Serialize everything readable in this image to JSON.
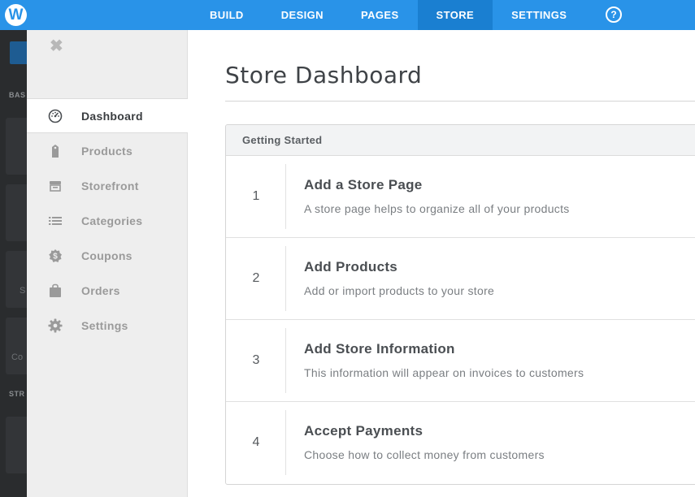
{
  "app": {
    "logo_letter": "W"
  },
  "nav": {
    "items": [
      {
        "label": "BUILD"
      },
      {
        "label": "DESIGN"
      },
      {
        "label": "PAGES"
      },
      {
        "label": "STORE"
      },
      {
        "label": "SETTINGS"
      }
    ],
    "active": "STORE",
    "help_label": "?"
  },
  "editor_strip": {
    "labels": [
      "BAS",
      "STR"
    ],
    "texts": [
      "S",
      "Co"
    ]
  },
  "sidebar": {
    "close_icon": "close-icon",
    "items": [
      {
        "label": "Dashboard",
        "icon": "gauge-icon",
        "active": true
      },
      {
        "label": "Products",
        "icon": "tag-icon",
        "active": false
      },
      {
        "label": "Storefront",
        "icon": "storefront-icon",
        "active": false
      },
      {
        "label": "Categories",
        "icon": "list-icon",
        "active": false
      },
      {
        "label": "Coupons",
        "icon": "coupon-icon",
        "active": false
      },
      {
        "label": "Orders",
        "icon": "shopping-bag-icon",
        "active": false
      },
      {
        "label": "Settings",
        "icon": "gear-icon",
        "active": false
      }
    ]
  },
  "main": {
    "title": "Store Dashboard",
    "panel": {
      "header": "Getting Started",
      "steps": [
        {
          "number": "1",
          "title": "Add a Store Page",
          "description": "A store page helps to organize all of your products"
        },
        {
          "number": "2",
          "title": "Add Products",
          "description": "Add or import products to your store"
        },
        {
          "number": "3",
          "title": "Add Store Information",
          "description": "This information will appear on invoices to customers"
        },
        {
          "number": "4",
          "title": "Accept Payments",
          "description": "Choose how to collect money from customers"
        }
      ]
    }
  },
  "colors": {
    "brand_blue": "#2993e8",
    "active_nav": "#1a7fd1",
    "sidebar_bg": "#eeeeee",
    "editor_dark": "#2a2c2e"
  }
}
